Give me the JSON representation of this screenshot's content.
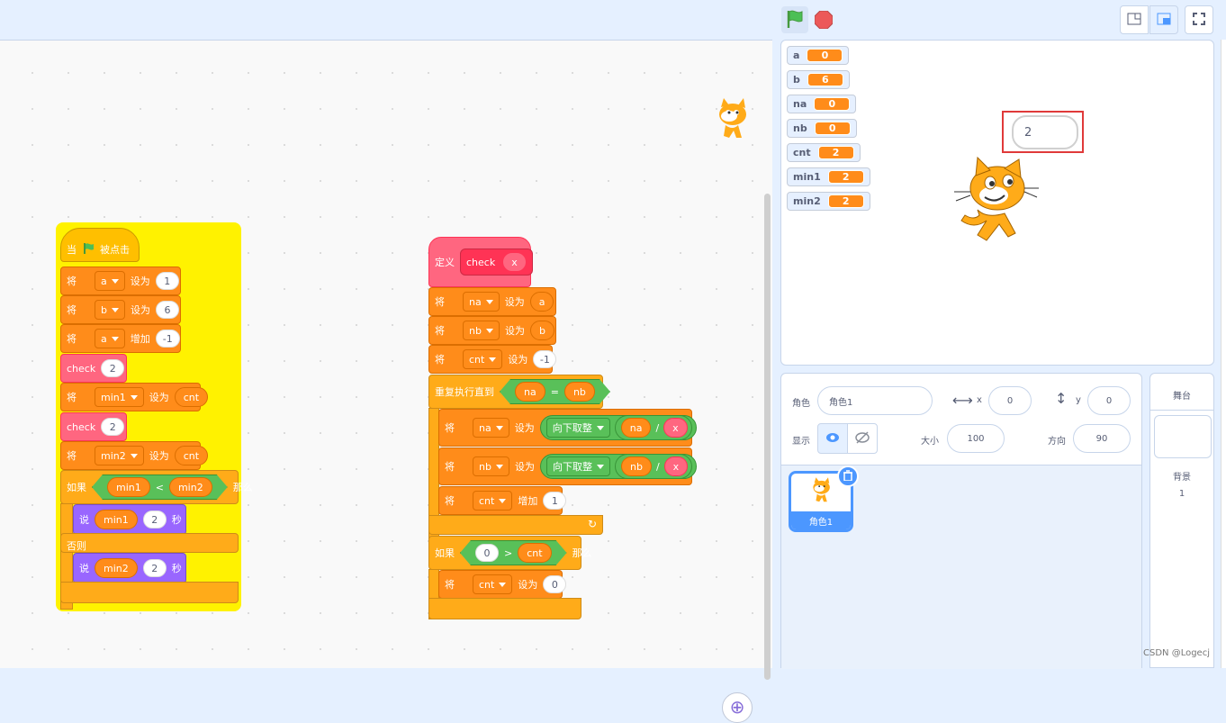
{
  "stage_header": {
    "flag_icon": "green-flag-icon",
    "stop_icon": "stop-sign-icon"
  },
  "script1": {
    "hat": {
      "when": "当",
      "clicked": "被点击"
    },
    "set_a": {
      "verb": "将",
      "var": "a",
      "op": "设为",
      "value": "1"
    },
    "set_b": {
      "verb": "将",
      "var": "b",
      "op": "设为",
      "value": "6"
    },
    "change_a": {
      "verb": "将",
      "var": "a",
      "op": "增加",
      "value": "-1"
    },
    "call1": {
      "name": "check",
      "value": "2"
    },
    "set_min1": {
      "verb": "将",
      "var": "min1",
      "op": "设为",
      "value": "cnt"
    },
    "call2": {
      "name": "check",
      "value": "2"
    },
    "set_min2": {
      "verb": "将",
      "var": "min2",
      "op": "设为",
      "value": "cnt"
    },
    "ifelse": {
      "if": "如果",
      "left": "min1",
      "op": "<",
      "right": "min2",
      "then": "那么",
      "else": "否则"
    },
    "say1": {
      "verb": "说",
      "value": "min1",
      "secs": "2",
      "unit": "秒"
    },
    "say2": {
      "verb": "说",
      "value": "min2",
      "secs": "2",
      "unit": "秒"
    }
  },
  "script2": {
    "define": {
      "label": "定义",
      "name": "check",
      "param": "x"
    },
    "set_na": {
      "verb": "将",
      "var": "na",
      "op": "设为",
      "value": "a"
    },
    "set_nb": {
      "verb": "将",
      "var": "nb",
      "op": "设为",
      "value": "b"
    },
    "set_cnt": {
      "verb": "将",
      "var": "cnt",
      "op": "设为",
      "value": "-1"
    },
    "repeat": {
      "label": "重复执行直到",
      "left": "na",
      "op": "=",
      "right": "nb"
    },
    "set_na2": {
      "verb": "将",
      "var": "na",
      "op": "设为",
      "func": "向下取整",
      "left": "na",
      "div": "/",
      "right": "x"
    },
    "set_nb2": {
      "verb": "将",
      "var": "nb",
      "op": "设为",
      "func": "向下取整",
      "left": "nb",
      "div": "/",
      "right": "x"
    },
    "change_cnt": {
      "verb": "将",
      "var": "cnt",
      "op": "增加",
      "value": "1"
    },
    "if": {
      "if": "如果",
      "left": "0",
      "op": ">",
      "right": "cnt",
      "then": "那么"
    },
    "set_cnt0": {
      "verb": "将",
      "var": "cnt",
      "op": "设为",
      "value": "0"
    }
  },
  "monitors": [
    {
      "name": "a",
      "value": "0"
    },
    {
      "name": "b",
      "value": "6"
    },
    {
      "name": "na",
      "value": "0"
    },
    {
      "name": "nb",
      "value": "0"
    },
    {
      "name": "cnt",
      "value": "2"
    },
    {
      "name": "min1",
      "value": "2"
    },
    {
      "name": "min2",
      "value": "2"
    }
  ],
  "bubble": {
    "text": "2"
  },
  "sprite_info": {
    "sprite_label": "角色",
    "sprite_name": "角色1",
    "x_label": "x",
    "x_value": "0",
    "y_label": "y",
    "y_value": "0",
    "show_label": "显示",
    "size_label": "大小",
    "size_value": "100",
    "direction_label": "方向",
    "direction_value": "90"
  },
  "sprite_list": [
    {
      "name": "角色1"
    }
  ],
  "stage_panel": {
    "title": "舞台",
    "backdrop_label": "背景",
    "backdrop_count": "1"
  },
  "watermark": "CSDN @Logecj",
  "colors": {
    "motion_var": "#ff8c1a",
    "control": "#ffab19",
    "custom": "#ff6680",
    "looks": "#9966ff",
    "operators": "#59c059",
    "highlight": "#fff200",
    "accent": "#4c97ff"
  }
}
